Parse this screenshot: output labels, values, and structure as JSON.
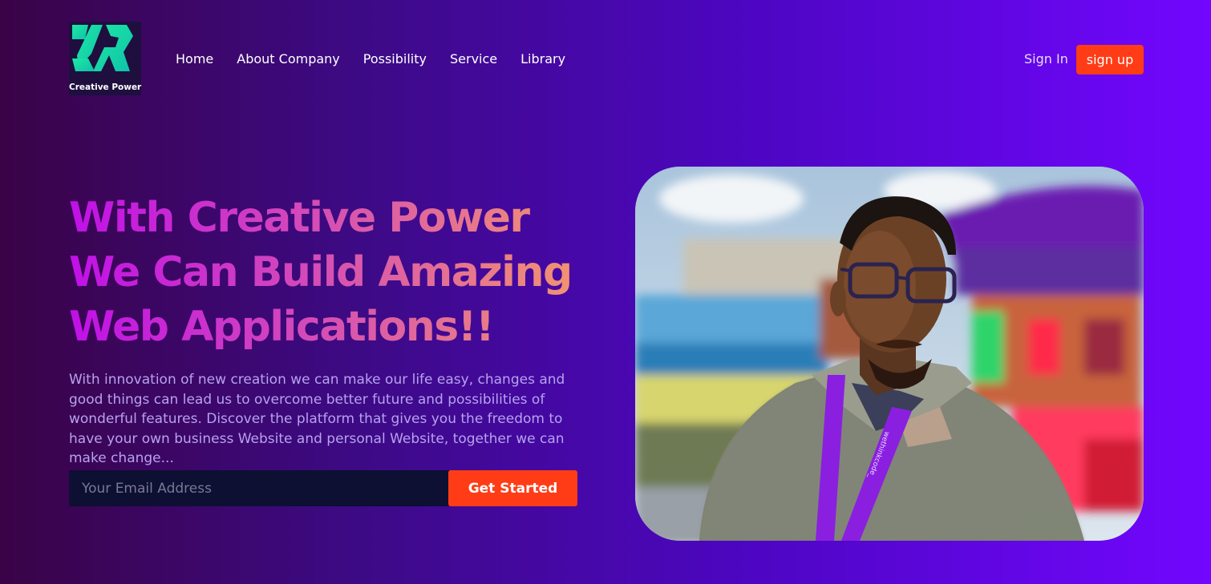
{
  "brand": {
    "name": "Creative Power",
    "logo_icon": "zr-logo-icon"
  },
  "nav": {
    "items": [
      {
        "label": "Home"
      },
      {
        "label": "About Company"
      },
      {
        "label": "Possibility"
      },
      {
        "label": "Service"
      },
      {
        "label": "Library"
      }
    ]
  },
  "auth": {
    "sign_in": "Sign In",
    "sign_up": "sign up"
  },
  "hero": {
    "title": "With Creative Power We Can Build Amazing Web Applications!!",
    "description": "With innovation of new creation we can make our life easy, changes and good things can lead us to overcome better future and possibilities of wonderful features. Discover the platform that gives you the freedom to have your own business Website and personal Website, together we can make change...",
    "email_placeholder": "Your Email Address",
    "cta": "Get Started"
  },
  "photo": {
    "lanyard_text": "wethinkcode_"
  },
  "colors": {
    "accent": "#ff3c16",
    "bg_start": "#3a0347",
    "bg_end": "#7206ff",
    "title_gradient": [
      "#c010e8",
      "#f59a6a"
    ],
    "logo_green": "#1de9a6"
  }
}
